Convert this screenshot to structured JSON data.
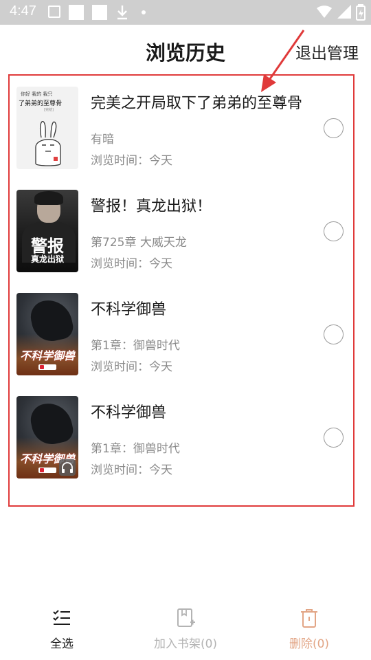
{
  "status_bar": {
    "time": "4:47"
  },
  "header": {
    "title": "浏览历史",
    "exit_label": "退出管理"
  },
  "books": [
    {
      "title": "完美之开局取下了弟弟的至尊骨",
      "chapter": "有暗",
      "browse_time": "浏览时间：今天",
      "cover_text": {
        "top": "你好 我的 我只",
        "main": "了弟弟的至尊骨",
        "tag": "[完结]"
      }
    },
    {
      "title": "警报！真龙出狱！",
      "chapter": "第725章 大威天龙",
      "browse_time": "浏览时间：今天",
      "cover_text": {
        "main": "警报",
        "sub": "真龙出狱"
      }
    },
    {
      "title": "不科学御兽",
      "chapter": "第1章：御兽时代",
      "browse_time": "浏览时间：今天",
      "cover_text": {
        "main": "不科学御兽"
      }
    },
    {
      "title": "不科学御兽",
      "chapter": "第1章：御兽时代",
      "browse_time": "浏览时间：今天",
      "cover_text": {
        "main": "不科学御兽"
      }
    }
  ],
  "bottom_bar": {
    "select_all_label": "全选",
    "add_to_shelf_label": "加入书架(0)",
    "delete_label": "删除(0)"
  },
  "colors": {
    "annotation_red": "#e03a3a",
    "delete_accent": "#e2a585",
    "disabled_gray": "#b3b3b3",
    "secondary_text": "#8a8a8a"
  },
  "icons": {
    "select_all": "checklist-icon",
    "add_to_shelf": "bookshelf-add-icon",
    "delete": "trash-icon",
    "audio": "headphones-icon"
  }
}
